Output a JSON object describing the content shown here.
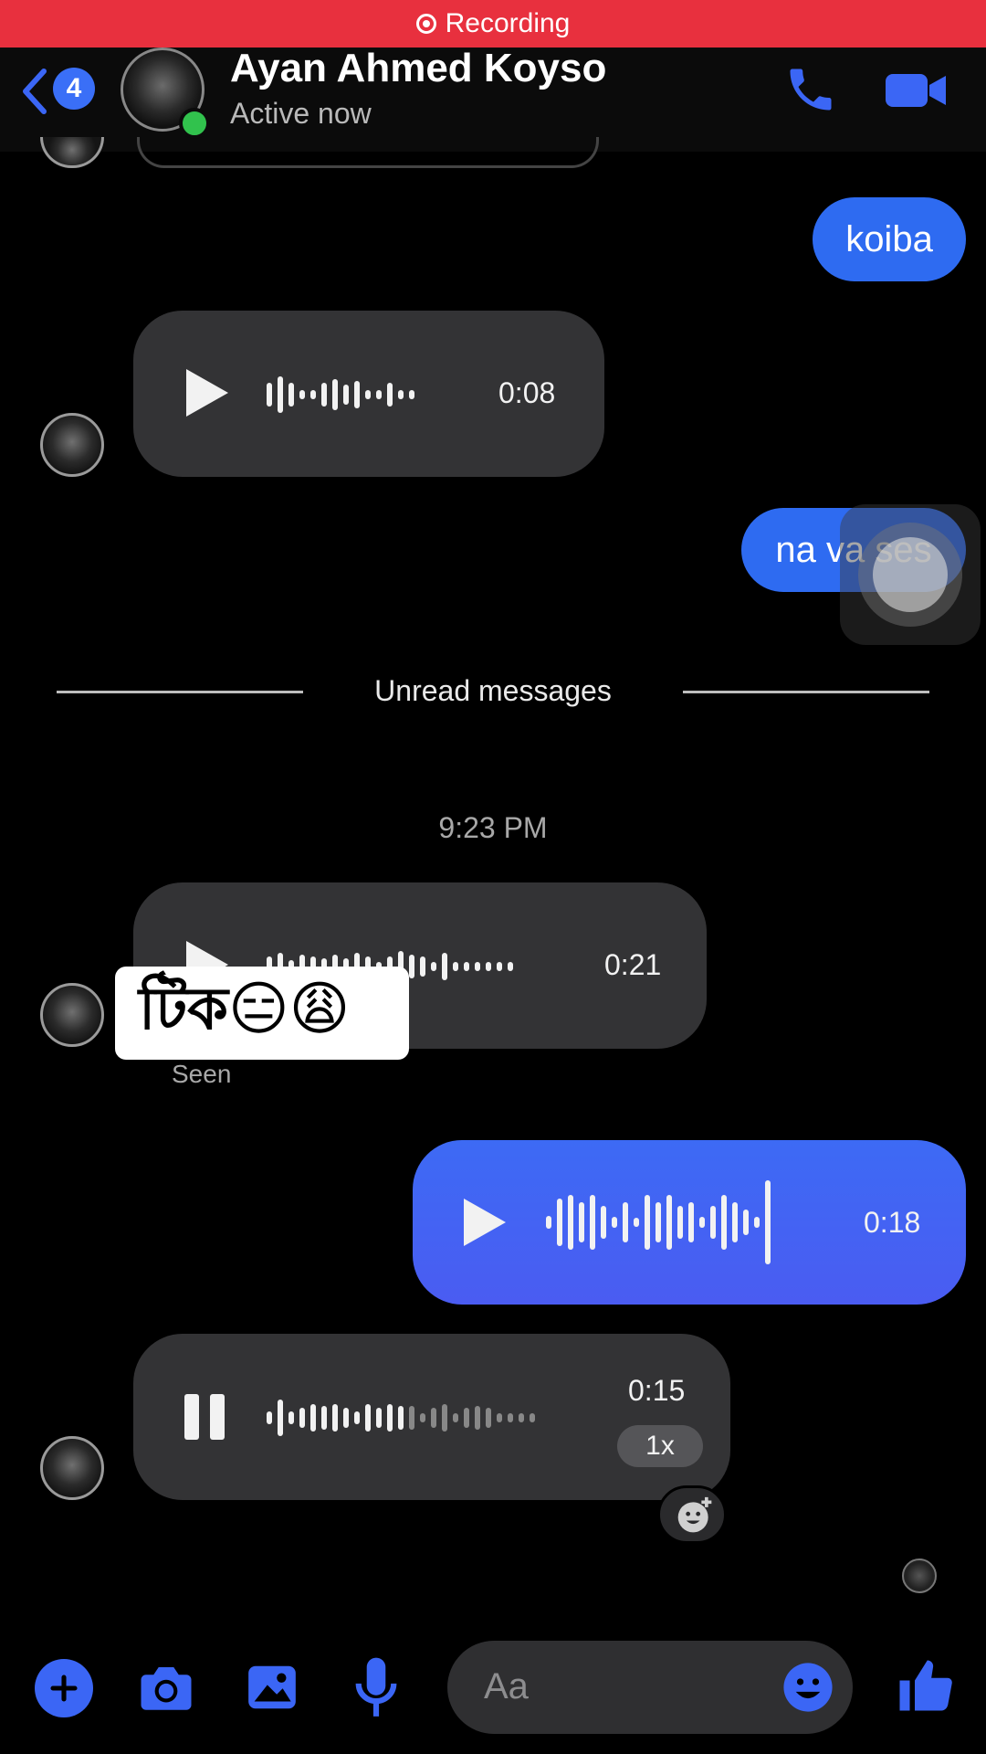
{
  "recording_bar": {
    "label": "Recording"
  },
  "header": {
    "back_count": "4",
    "contact_name": "Ayan Ahmed Koyso",
    "status": "Active now"
  },
  "messages": {
    "out_1": "koiba",
    "voice_in_1_duration": "0:08",
    "out_2": "na va ses",
    "unread_divider": "Unread messages",
    "timestamp": "9:23 PM",
    "voice_in_2_duration": "0:21",
    "sticker_text": "টিক😑😩",
    "seen_label": "Seen",
    "voice_out_duration": "0:18",
    "voice_in_3_duration": "0:15",
    "voice_in_3_speed": "1x"
  },
  "composer": {
    "placeholder": "Aa"
  },
  "colors": {
    "accent": "#3b66f5",
    "recording": "#e8303e",
    "bubble_in": "#333335"
  }
}
